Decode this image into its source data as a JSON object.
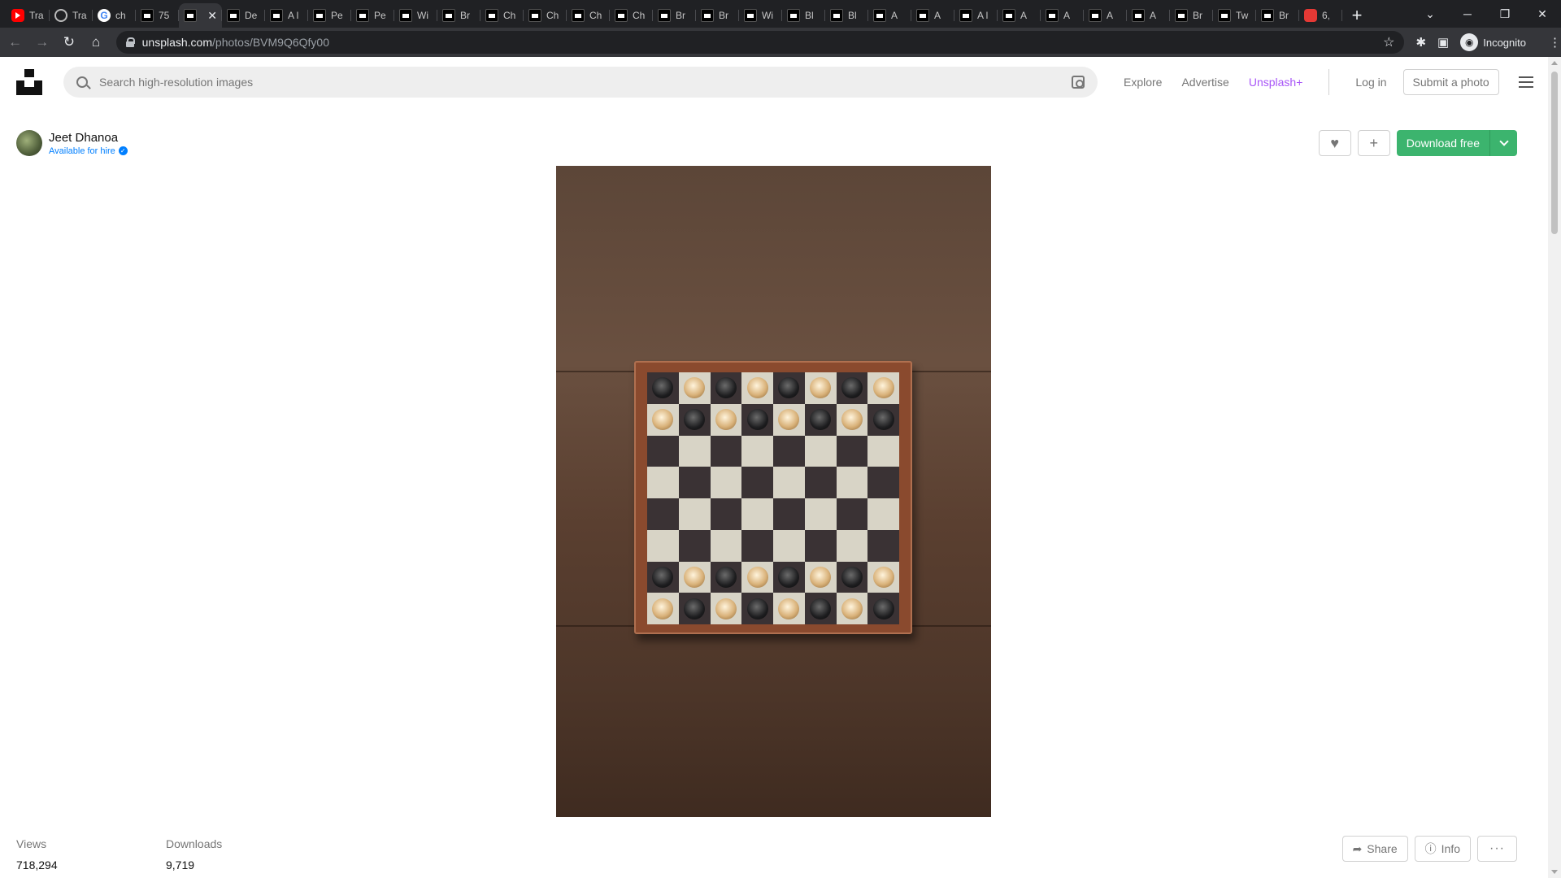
{
  "browser": {
    "tabs": [
      {
        "label": "Tra",
        "favicon": "youtube-icon"
      },
      {
        "label": "Tra",
        "favicon": "globe-icon"
      },
      {
        "label": "ch",
        "favicon": "google-icon"
      },
      {
        "label": "75",
        "favicon": "unsplash-icon"
      },
      {
        "label": "",
        "favicon": "unsplash-icon",
        "active": true
      },
      {
        "label": "De",
        "favicon": "unsplash-icon"
      },
      {
        "label": "A l",
        "favicon": "unsplash-icon"
      },
      {
        "label": "Pe",
        "favicon": "unsplash-icon"
      },
      {
        "label": "Pe",
        "favicon": "unsplash-icon"
      },
      {
        "label": "Wi",
        "favicon": "unsplash-icon"
      },
      {
        "label": "Br",
        "favicon": "unsplash-icon"
      },
      {
        "label": "Ch",
        "favicon": "unsplash-icon"
      },
      {
        "label": "Ch",
        "favicon": "unsplash-icon"
      },
      {
        "label": "Ch",
        "favicon": "unsplash-icon"
      },
      {
        "label": "Ch",
        "favicon": "unsplash-icon"
      },
      {
        "label": "Br",
        "favicon": "unsplash-icon"
      },
      {
        "label": "Br",
        "favicon": "unsplash-icon"
      },
      {
        "label": "Wi",
        "favicon": "unsplash-icon"
      },
      {
        "label": "Bl",
        "favicon": "unsplash-icon"
      },
      {
        "label": "Bl",
        "favicon": "unsplash-icon"
      },
      {
        "label": "A",
        "favicon": "unsplash-icon"
      },
      {
        "label": "A",
        "favicon": "unsplash-icon"
      },
      {
        "label": "A l",
        "favicon": "unsplash-icon"
      },
      {
        "label": "A",
        "favicon": "unsplash-icon"
      },
      {
        "label": "A",
        "favicon": "unsplash-icon"
      },
      {
        "label": "A",
        "favicon": "unsplash-icon"
      },
      {
        "label": "A",
        "favicon": "unsplash-icon"
      },
      {
        "label": "Br",
        "favicon": "unsplash-icon"
      },
      {
        "label": "Tw",
        "favicon": "unsplash-icon"
      },
      {
        "label": "Br",
        "favicon": "unsplash-icon"
      },
      {
        "label": "6,",
        "favicon": "red-icon"
      }
    ],
    "url_host": "unsplash.com",
    "url_path": "/photos/BVM9Q6Qfy00",
    "profile": "Incognito"
  },
  "header": {
    "search_placeholder": "Search high-resolution images",
    "nav": [
      "Explore",
      "Advertise",
      "Unsplash+"
    ],
    "login": "Log in",
    "submit": "Submit a photo"
  },
  "author": {
    "name": "Jeet Dhanoa",
    "hire": "Available for hire"
  },
  "actions": {
    "download": "Download free"
  },
  "stats": {
    "views_label": "Views",
    "views": "718,294",
    "downloads_label": "Downloads",
    "downloads": "9,719"
  },
  "footer_actions": {
    "share": "Share",
    "info": "Info",
    "more": "···"
  },
  "colors": {
    "download_green": "#3cb46e",
    "unsplash_plus": "#a855f7",
    "hire_blue": "#007fff"
  }
}
